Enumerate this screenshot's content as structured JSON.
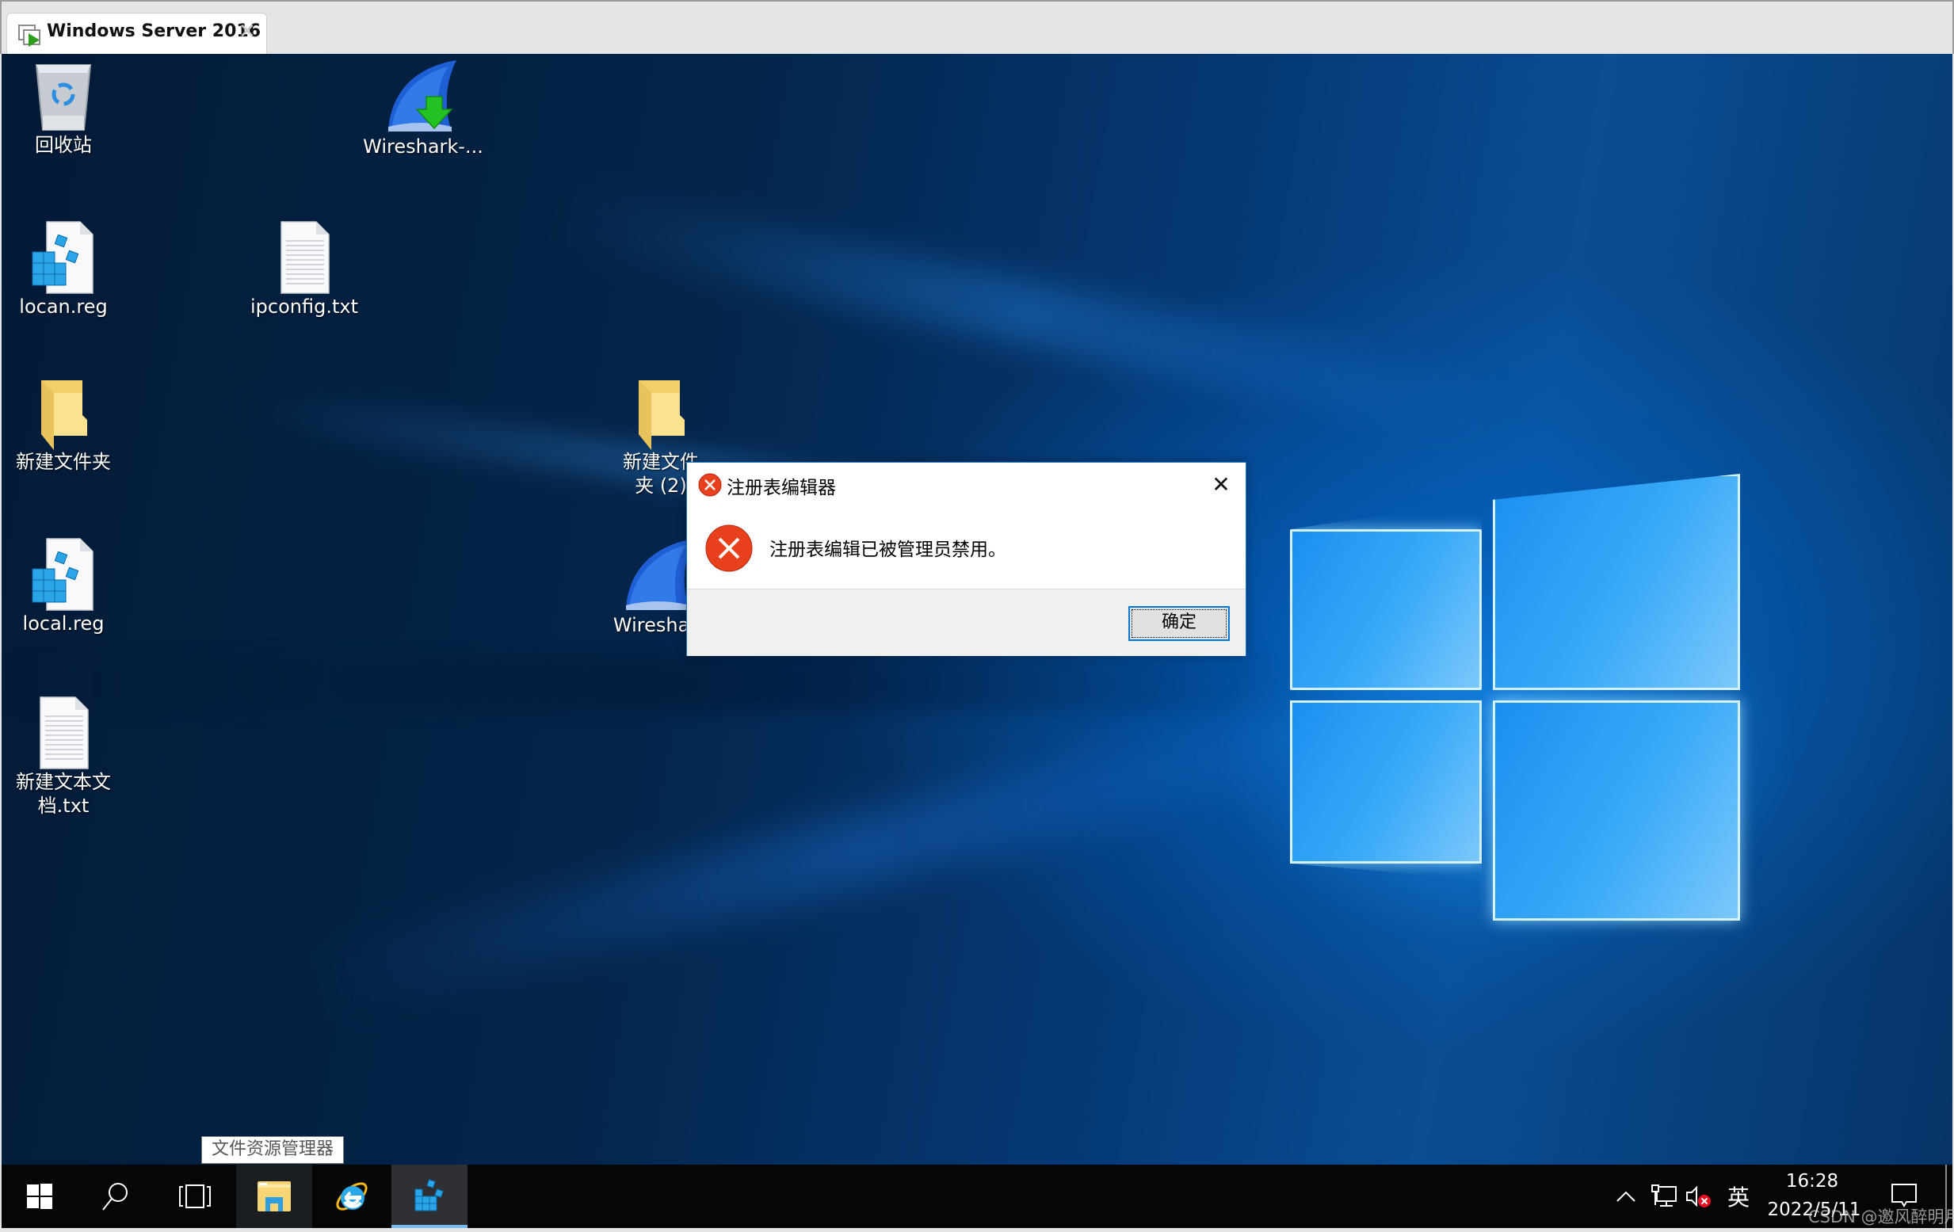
{
  "vm_tab": {
    "title": "Windows Server 2016",
    "close_glyph": "✕",
    "icon": "vm-console-icon"
  },
  "desktop": {
    "icons": [
      {
        "label": "回收站",
        "icon": "recycle-bin-icon"
      },
      {
        "label": "Wireshark-...",
        "icon": "wireshark-installer-icon"
      },
      {
        "label": "locan.reg",
        "icon": "registry-file-icon"
      },
      {
        "label": "ipconfig.txt",
        "icon": "text-file-icon"
      },
      {
        "label": "新建文件夹",
        "icon": "folder-icon"
      },
      {
        "label": "新建文件夹 (2)",
        "icon": "folder-icon"
      },
      {
        "label": "local.reg",
        "icon": "registry-file-icon"
      },
      {
        "label": "Wireshark",
        "icon": "wireshark-icon"
      },
      {
        "label": "新建文本文档.txt",
        "icon": "text-file-icon"
      }
    ]
  },
  "dialog": {
    "title": "注册表编辑器",
    "message": "注册表编辑已被管理员禁用。",
    "ok_label": "确定",
    "close_glyph": "✕",
    "icon": "error-icon",
    "error_color": "#e8401c"
  },
  "tooltip": {
    "text": "文件资源管理器"
  },
  "taskbar": {
    "buttons": [
      {
        "name": "start",
        "icon": "windows-start-icon"
      },
      {
        "name": "search",
        "icon": "search-icon"
      },
      {
        "name": "task-view",
        "icon": "task-view-icon"
      },
      {
        "name": "file-explorer",
        "icon": "file-explorer-icon"
      },
      {
        "name": "internet-explorer",
        "icon": "internet-explorer-icon"
      },
      {
        "name": "registry-editor",
        "icon": "registry-editor-icon",
        "active": true
      }
    ],
    "tray": {
      "chevron": "^",
      "network_icon": "network-icon",
      "volume_icon": "volume-muted-icon",
      "ime_label": "英",
      "time": "16:28",
      "date": "2022/5/11",
      "action_center_icon": "action-center-icon"
    },
    "accent_color": "#76b9ed"
  },
  "watermark": "CSDN @邀风醉明月"
}
